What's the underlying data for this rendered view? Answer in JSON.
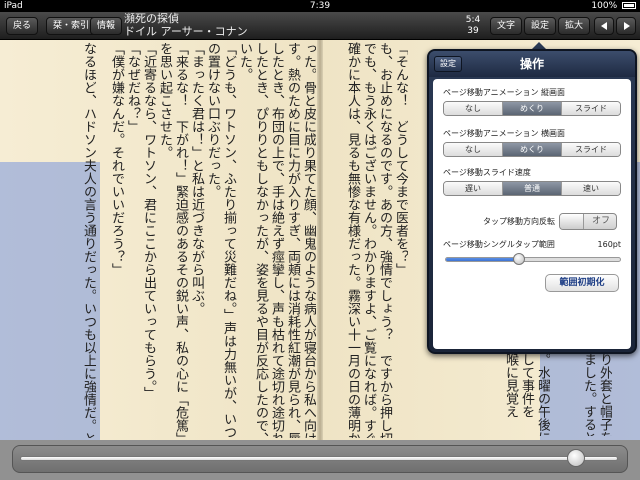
{
  "status": {
    "device": "iPad",
    "time": "7:39",
    "battery": "100%"
  },
  "toolbar": {
    "back": "戻る",
    "bookmark": "栞・索引",
    "info": "情報",
    "title": "瀕死の探偵",
    "author": "ドイル アーサー・コナン",
    "page_current": "5:4",
    "page_total": "39",
    "text": "文字",
    "settings": "設定",
    "zoom": "拡大"
  },
  "book": {
    "right_columns": [
      "「そんな！　どうして今まで医者を？」",
      "も、お止めになるのです。あの方、強情でしょう？　ですから押し切れなくて。",
      "でも、もう永くはございません。わかりますよ、ご覧になれば。すぐ。」",
      "確かに本人は、見るも無惨な有様だった。霧深い十一月の日の薄明かりだ。病"
    ],
    "left_columns": [
      "った。骨と皮に成り果てた顔、幽鬼のような病人が寝台から私へ向けられた憔悴の顔が、私の肝を冷や",
      "す。熱のために目に力が入りすぎ、両頬には消耗性紅潮が見られ、唇は変色し",
      "したとき、布団の上で、手は絶えず痙攣し、声も枯れて途切れ途切れだ。私が入室",
      "したとき、ぴりりともしなかったが、姿を見るや目が反応したので、気づいては",
      "いた。",
      "「どうも、ワトソン、ふたり揃って災難だね。」声は力無いが、いつも通りの口",
      "の置けない口ぶりだった。",
      "「まったく君は！」と私は近づきながら叫ぶ。",
      "「来るな！　下がれ！」緊迫感のあるその鋭い声、私の心に「危篤」の二文字",
      "を思い起こさせた。",
      "「近寄るなら、ワトソン、君にここから出ていってもらう。」",
      "「なぜだね？」",
      "「僕が嫌なんだ。それでいいだろう？」",
      "なるほど、ハドソン夫人の言う通りだった。いつも以上に強情だ。とはいえ、"
    ],
    "partial_right": [
      "る。水曜の午後に",
      "断して事件を",
      "、喉に見覚え"
    ],
    "partial_left": [
      "すり外套と帽子を",
      "りました。すると"
    ]
  },
  "popover": {
    "back": "設定",
    "title": "操作",
    "anim_portrait": {
      "label": "ページ移動アニメーション 縦画面",
      "options": [
        "なし",
        "めくり",
        "スライド"
      ],
      "selected": 1
    },
    "anim_landscape": {
      "label": "ページ移動アニメーション 横画面",
      "options": [
        "なし",
        "めくり",
        "スライド"
      ],
      "selected": 1
    },
    "slide_speed": {
      "label": "ページ移動スライド速度",
      "options": [
        "遅い",
        "普通",
        "速い"
      ],
      "selected": 1
    },
    "tap_reverse": {
      "label": "タップ移動方向反転",
      "state": "オフ"
    },
    "single_tap": {
      "label": "ページ移動シングルタップ範囲",
      "value": "160pt",
      "fraction": 0.42
    },
    "reset": "範囲初期化"
  },
  "progress": {
    "fraction": 0.93
  },
  "colors": {
    "toolbar": "#2a2a2a",
    "paper": "#f4ead0",
    "highlight": "#7896dc",
    "popover": "#1e2a42",
    "accent": "#2b63c6"
  }
}
